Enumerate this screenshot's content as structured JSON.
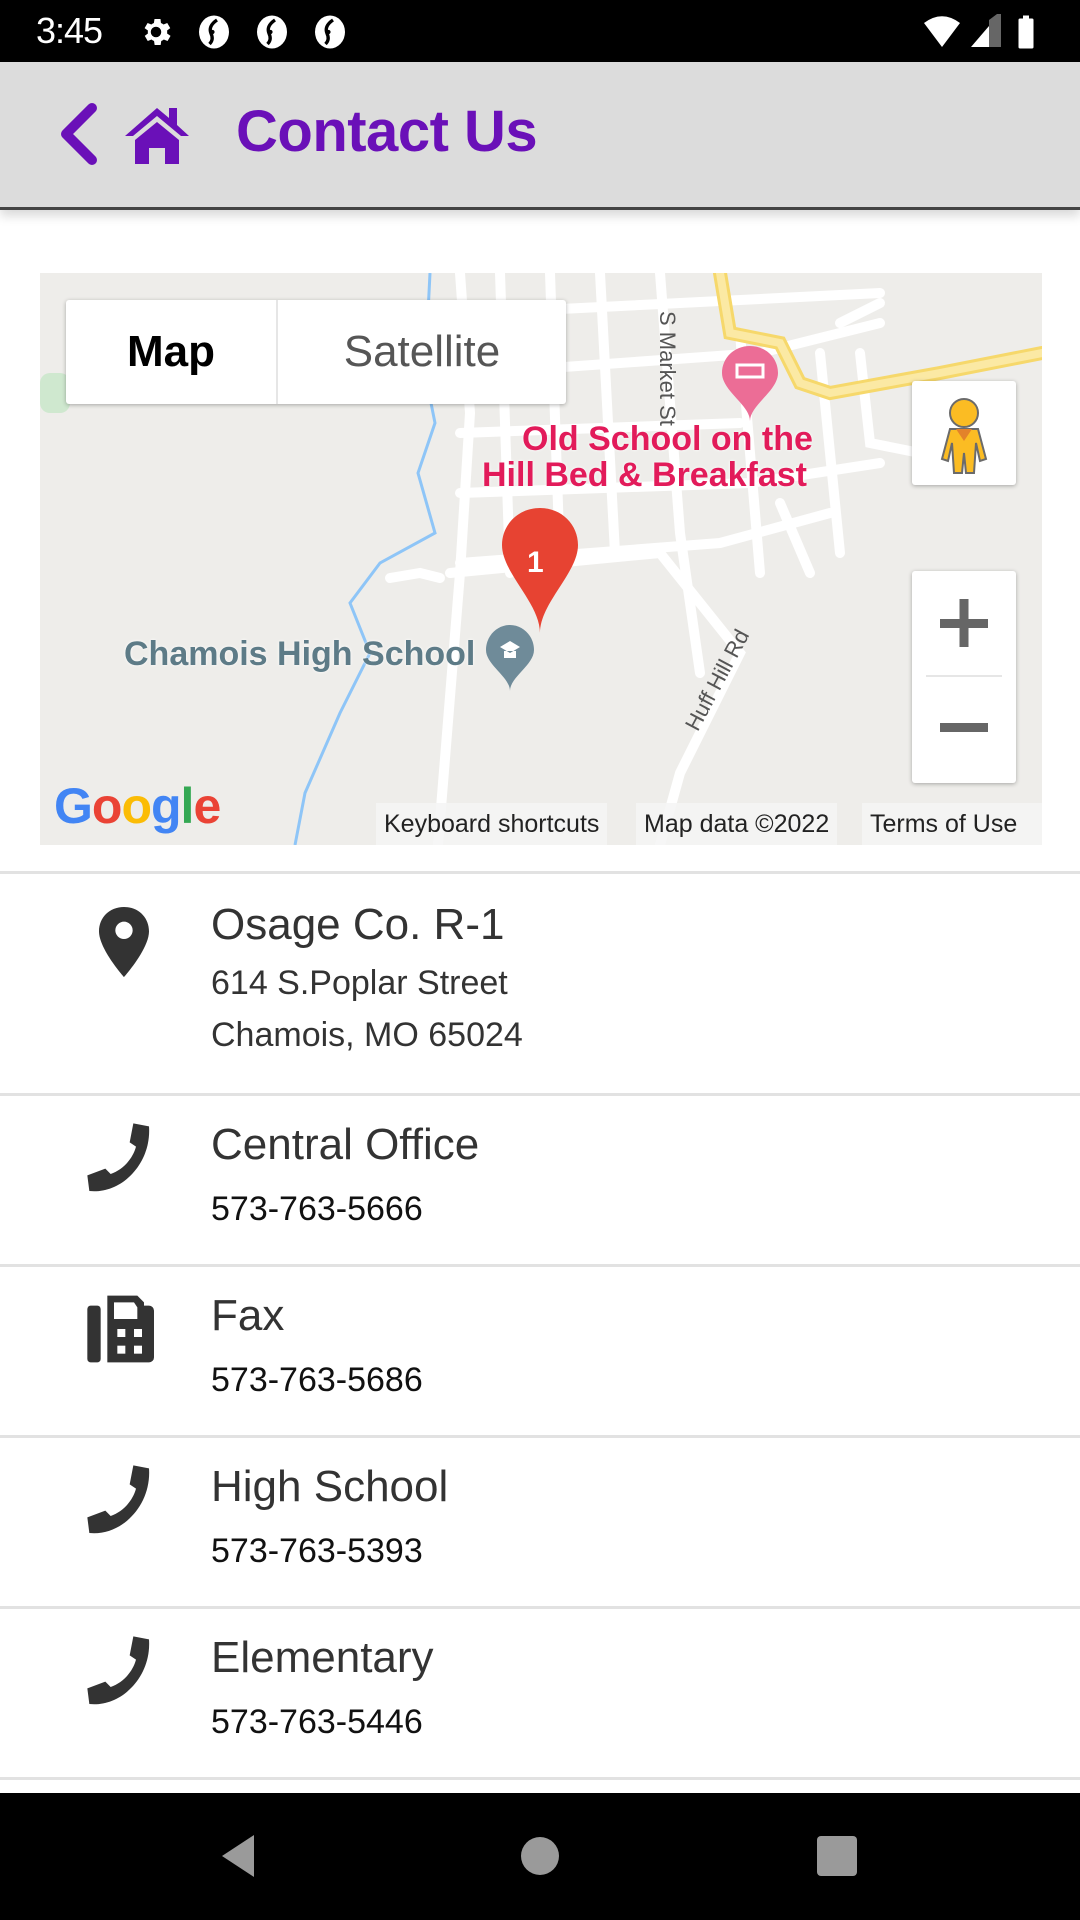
{
  "status_bar": {
    "time": "3:45",
    "left_icons": [
      "settings-icon",
      "sync-app-icon",
      "sync-app-icon",
      "sync-app-icon"
    ],
    "right_icons": [
      "wifi-icon",
      "cell-signal-icon",
      "battery-icon"
    ]
  },
  "app_bar": {
    "back_icon": "chevron-left-icon",
    "home_icon": "home-icon",
    "title": "Contact Us",
    "accent_color": "#6a10b8"
  },
  "map": {
    "map_type_options": [
      "Map",
      "Satellite"
    ],
    "selected_map_type": "Map",
    "labels": {
      "poi_bnb_line1": "Old School on the",
      "poi_bnb_line2": "Hill Bed & Breakfast",
      "school": "Chamois High School",
      "street_market": "S Market St",
      "street_huff": "Huff Hill Rd"
    },
    "marker_label": "1",
    "logo": "Google",
    "attribution": {
      "keyboard": "Keyboard shortcuts",
      "map_data": "Map data ©2022",
      "terms": "Terms of Use"
    },
    "zoom_in": "+",
    "zoom_out": "−"
  },
  "contacts": [
    {
      "icon": "location-pin-icon",
      "title": "Osage Co. R-1",
      "lines": [
        "614 S.Poplar Street",
        "Chamois, MO  65024"
      ]
    },
    {
      "icon": "phone-icon",
      "title": "Central Office",
      "phone": "573-763-5666"
    },
    {
      "icon": "fax-icon",
      "title": "Fax",
      "phone": "573-763-5686"
    },
    {
      "icon": "phone-icon",
      "title": "High School",
      "phone": "573-763-5393"
    },
    {
      "icon": "phone-icon",
      "title": "Elementary",
      "phone": "573-763-5446"
    }
  ],
  "nav_bar": {
    "buttons": [
      "back-nav-icon",
      "home-nav-icon",
      "recents-nav-icon"
    ]
  }
}
